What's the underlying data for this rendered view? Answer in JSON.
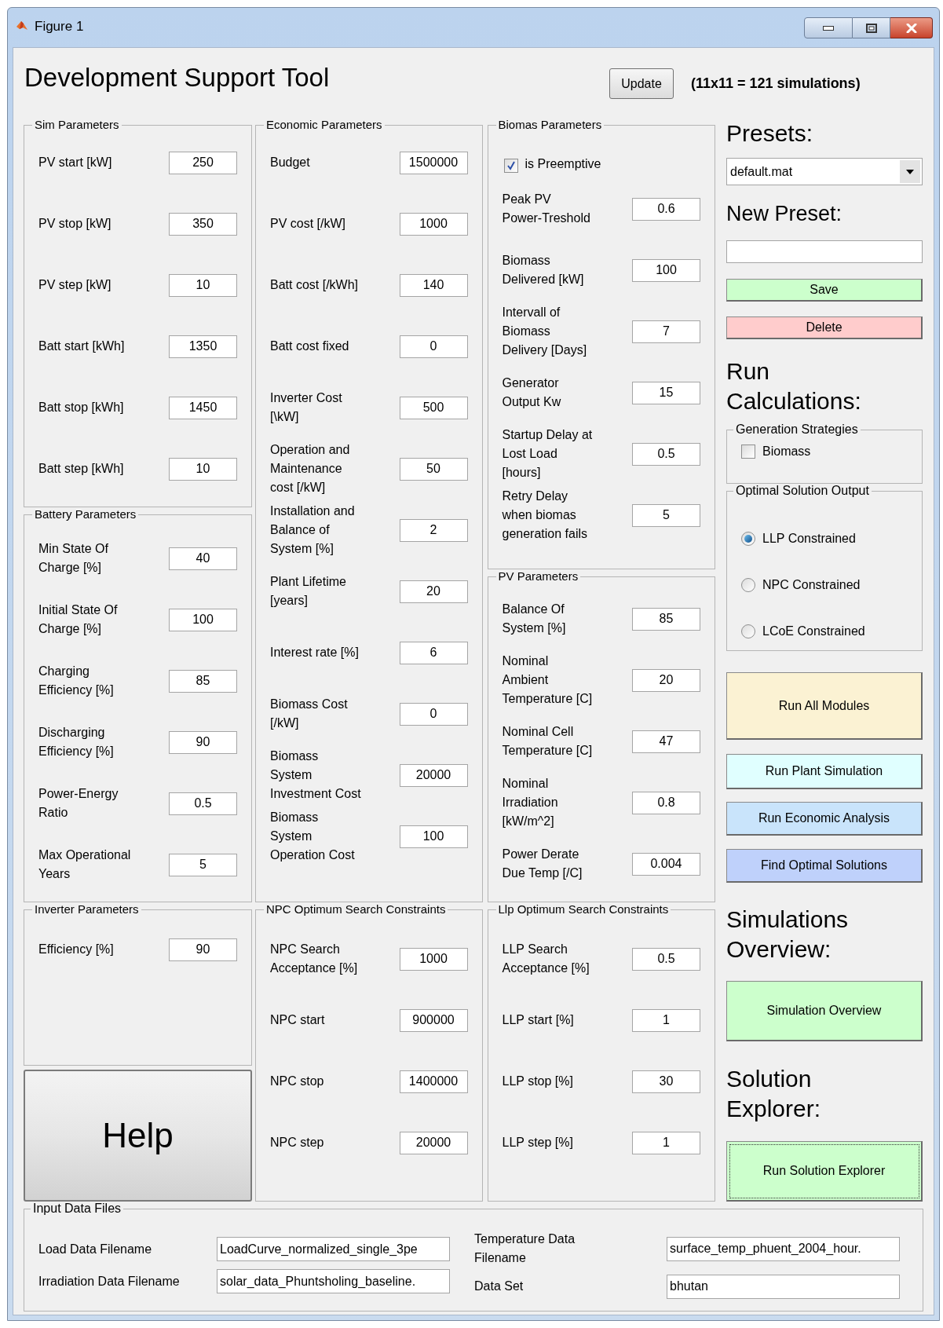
{
  "window": {
    "title": "Figure 1"
  },
  "header": {
    "title": "Development Support Tool",
    "update_button": "Update",
    "simulation_count": "(11x11 = 121 simulations)"
  },
  "panel_columns": [
    [
      {
        "title": "Sim Parameters",
        "rows": [
          {
            "kind": "field",
            "label": "PV start [kW]",
            "value": "250"
          },
          {
            "kind": "field",
            "label": "PV stop [kW]",
            "value": "350"
          },
          {
            "kind": "field",
            "label": "PV step [kW]",
            "value": "10"
          },
          {
            "kind": "field",
            "label": "Batt start [kWh]",
            "value": "1350"
          },
          {
            "kind": "field",
            "label": "Batt stop [kWh]",
            "value": "1450"
          },
          {
            "kind": "field",
            "label": "Batt step [kWh]",
            "value": "10"
          }
        ]
      },
      {
        "title": "Battery Parameters",
        "rows": [
          {
            "kind": "field",
            "label": "Min State Of\nCharge [%]",
            "value": "40"
          },
          {
            "kind": "field",
            "label": "Initial State Of\nCharge [%]",
            "value": "100"
          },
          {
            "kind": "field",
            "label": "Charging\nEfficiency [%]",
            "value": "85"
          },
          {
            "kind": "field",
            "label": "Discharging\nEfficiency [%]",
            "value": "90"
          },
          {
            "kind": "field",
            "label": "Power-Energy\nRatio",
            "value": "0.5"
          },
          {
            "kind": "field",
            "label": "Max Operational\nYears",
            "value": "5"
          }
        ]
      },
      {
        "title": "Inverter Parameters",
        "rows": [
          {
            "kind": "field",
            "label": "Efficiency [%]",
            "value": "90"
          }
        ]
      }
    ],
    [
      {
        "title": "Economic Parameters",
        "rows": [
          {
            "kind": "field",
            "label": "Budget",
            "value": "1500000"
          },
          {
            "kind": "field",
            "label": "PV cost [/kW]",
            "value": "1000"
          },
          {
            "kind": "field",
            "label": "Batt cost [/kWh]",
            "value": "140"
          },
          {
            "kind": "field",
            "label": "Batt cost fixed",
            "value": "0"
          },
          {
            "kind": "field",
            "label": "Inverter Cost\n[\\kW]",
            "value": "500"
          },
          {
            "kind": "field",
            "label": "Operation and\nMaintenance\ncost [/kW]",
            "value": "50"
          },
          {
            "kind": "field",
            "label": "Installation and\nBalance of\nSystem [%]",
            "value": "2"
          },
          {
            "kind": "field",
            "label": "Plant Lifetime\n[years]",
            "value": "20"
          },
          {
            "kind": "field",
            "label": "Interest rate [%]",
            "value": "6"
          },
          {
            "kind": "field",
            "label": "Biomass Cost\n[/kW]",
            "value": "0"
          },
          {
            "kind": "field",
            "label": "Biomass\nSystem\nInvestment Cost",
            "value": "20000"
          },
          {
            "kind": "field",
            "label": "Biomass\nSystem\nOperation Cost",
            "value": "100"
          }
        ]
      },
      {
        "title": "NPC Optimum Search Constraints",
        "rows": [
          {
            "kind": "field",
            "label": "NPC Search\nAcceptance [%]",
            "value": "1000"
          },
          {
            "kind": "field",
            "label": "NPC start",
            "value": "900000"
          },
          {
            "kind": "field",
            "label": "NPC stop",
            "value": "1400000"
          },
          {
            "kind": "field",
            "label": "NPC step",
            "value": "20000"
          }
        ]
      }
    ],
    [
      {
        "title": "Biomas Parameters",
        "rows": [
          {
            "kind": "checkbox",
            "label": "is Preemptive",
            "checked": true
          },
          {
            "kind": "field",
            "label": "Peak PV\nPower-Treshold",
            "value": "0.6"
          },
          {
            "kind": "field",
            "label": "Biomass\nDelivered [kW]",
            "value": "100"
          },
          {
            "kind": "field",
            "label": "Intervall of\nBiomass\nDelivery [Days]",
            "value": "7"
          },
          {
            "kind": "field",
            "label": "Generator\nOutput Kw",
            "value": "15"
          },
          {
            "kind": "field",
            "label": "Startup Delay at\nLost Load\n[hours]",
            "value": "0.5"
          },
          {
            "kind": "field",
            "label": "Retry Delay\nwhen biomas\ngeneration fails",
            "value": "5"
          }
        ]
      },
      {
        "title": "PV Parameters",
        "rows": [
          {
            "kind": "field",
            "label": "Balance Of\nSystem [%]",
            "value": "85"
          },
          {
            "kind": "field",
            "label": "Nominal\nAmbient\nTemperature [C]",
            "value": "20"
          },
          {
            "kind": "field",
            "label": "Nominal Cell\nTemperature [C]",
            "value": "47"
          },
          {
            "kind": "field",
            "label": "Nominal\nIrradiation\n[kW/m^2]",
            "value": "0.8"
          },
          {
            "kind": "field",
            "label": "Power Derate\nDue Temp [/C]",
            "value": "0.004"
          }
        ]
      },
      {
        "title": "Llp Optimum Search Constraints",
        "rows": [
          {
            "kind": "field",
            "label": "LLP Search\nAcceptance [%]",
            "value": "0.5"
          },
          {
            "kind": "field",
            "label": "LLP start [%]",
            "value": "1"
          },
          {
            "kind": "field",
            "label": "LLP stop [%]",
            "value": "30"
          },
          {
            "kind": "field",
            "label": "LLP step [%]",
            "value": "1"
          }
        ]
      }
    ]
  ],
  "help_button": "Help",
  "sidebar": {
    "presets_heading": "Presets:",
    "preset_dropdown": "default.mat",
    "new_preset_heading": "New Preset:",
    "save_button": "Save",
    "delete_button": "Delete",
    "run_heading": "Run\nCalculations:",
    "generation_strategies": {
      "title": "Generation Strategies",
      "options": [
        {
          "label": "Biomass",
          "checked": false
        }
      ]
    },
    "optimal_solution_output": {
      "title": "Optimal Solution Output",
      "options": [
        {
          "label": "LLP Constrained",
          "selected": true
        },
        {
          "label": "NPC Constrained",
          "selected": false
        },
        {
          "label": "LCoE Constrained",
          "selected": false
        }
      ]
    },
    "run_all_button": "Run All Modules",
    "plant_simulation_button": "Run Plant Simulation",
    "economic_analysis_button": "Run Economic Analysis",
    "optimal_solutions_button": "Find Optimal Solutions",
    "overview_heading": "Simulations\nOverview:",
    "simulation_overview_button": "Simulation Overview",
    "explorer_heading": "Solution\nExplorer:",
    "solution_explorer_button": "Run Solution Explorer"
  },
  "input_files": {
    "title": "Input Data Files",
    "fields": [
      {
        "label": "Load Data Filename",
        "value": "LoadCurve_normalized_single_3pe"
      },
      {
        "label": "Irradiation Data Filename",
        "value": "solar_data_Phuntsholing_baseline."
      },
      {
        "label": "Temperature Data\nFilename",
        "value": "surface_temp_phuent_2004_hour."
      },
      {
        "label": "Data Set",
        "value": "bhutan"
      }
    ]
  }
}
